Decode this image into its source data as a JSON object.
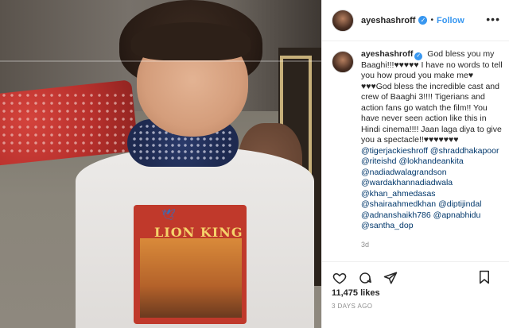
{
  "post": {
    "username": "ayeshashroff",
    "verified_glyph": "✓",
    "separator": "•",
    "follow_label": "Follow",
    "more_glyph": "•••",
    "photo": {
      "alt_icon": "post-photo",
      "shirt_print_text": "LION KING",
      "shirt_print_icon": "bird-icon"
    },
    "caption": {
      "username": "ayeshashroff",
      "text": "God bless you my Baaghi!!!♥♥♥♥♥ I have no words to tell you how proud you make me♥ ♥♥♥God bless the incredible cast and crew of Baaghi 3!!!! Tigerians and action fans go watch the film!! You have never seen action like this in Hindi cinema!!!! Jaan laga diya to give you a spectacle!!♥♥♥♥♥♥♥",
      "mentions": [
        "@tigerjackieshroff",
        "@shraddhakapoor",
        "@riteishd",
        "@lokhandeankita",
        "@nadiadwalagrandson",
        "@wardakhannadiadwala",
        "@khan_ahmedasas",
        "@shairaahmedkhan",
        "@diptijindal",
        "@adnanshaikh786",
        "@apnabhidu",
        "@santha_dop"
      ],
      "age": "3d"
    },
    "actions": {
      "like_icon": "heart-icon",
      "comment_icon": "comment-icon",
      "share_icon": "share-icon",
      "save_icon": "bookmark-icon"
    },
    "likes_label": "11,475 likes",
    "posted_label": "3 DAYS AGO"
  },
  "colors": {
    "accent": "#3897f0",
    "mention": "#00376b",
    "muted": "#8e8e8e"
  }
}
